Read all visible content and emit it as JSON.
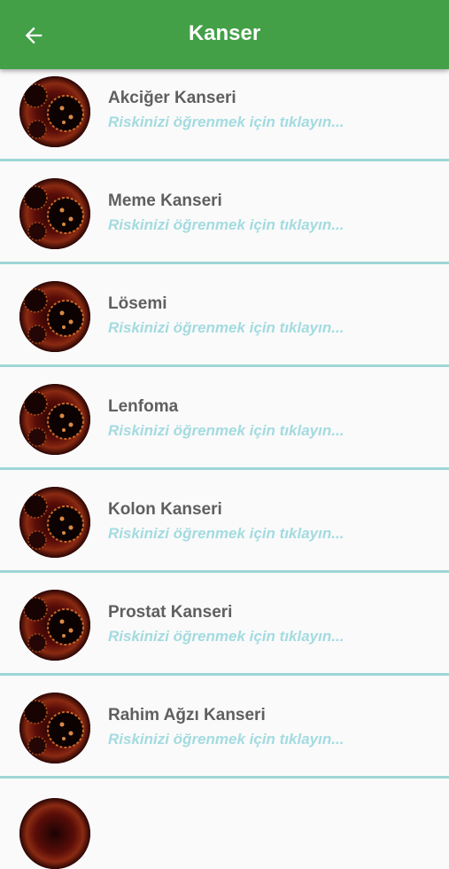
{
  "appbar": {
    "title": "Kanser",
    "back_icon": "arrow-left-icon",
    "color": "#43a047"
  },
  "list": {
    "items": [
      {
        "title": "Akciğer Kanseri",
        "subtitle": "Riskinizi öğrenmek için tıklayın..."
      },
      {
        "title": "Meme Kanseri",
        "subtitle": "Riskinizi öğrenmek için tıklayın..."
      },
      {
        "title": "Lösemi",
        "subtitle": "Riskinizi öğrenmek için tıklayın..."
      },
      {
        "title": "Lenfoma",
        "subtitle": "Riskinizi öğrenmek için tıklayın..."
      },
      {
        "title": "Kolon Kanseri",
        "subtitle": "Riskinizi öğrenmek için tıklayın..."
      },
      {
        "title": "Prostat Kanseri",
        "subtitle": "Riskinizi öğrenmek için tıklayın..."
      },
      {
        "title": "Rahim Ağzı Kanseri",
        "subtitle": "Riskinizi öğrenmek için tıklayın..."
      }
    ],
    "avatar_icon": "cancer-cell-image",
    "divider_color": "#9fd6d6",
    "subtitle_color": "#a3dbe0"
  }
}
